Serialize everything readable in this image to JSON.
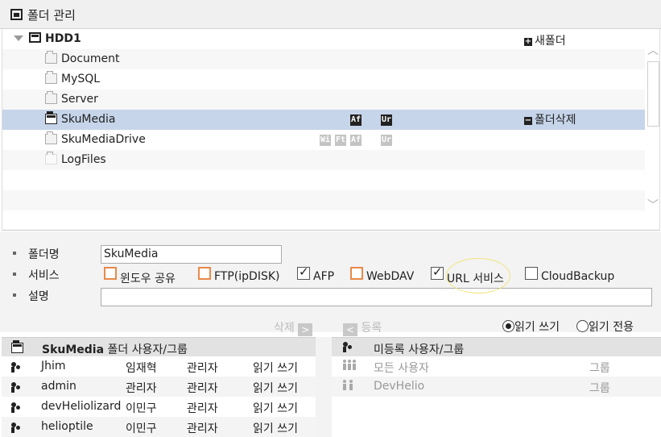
{
  "title": "폴더 관리",
  "tree": {
    "root": "HDD1",
    "new_folder": "새폴더",
    "delete_folder": "폴더삭제",
    "folders": [
      {
        "name": "Document",
        "badges": []
      },
      {
        "name": "MySQL",
        "badges": []
      },
      {
        "name": "Server",
        "badges": []
      },
      {
        "name": "SkuMedia",
        "badges": [
          "Af",
          "Ur"
        ],
        "selected": true
      },
      {
        "name": "SkuMediaDrive",
        "badges": [
          "Wi",
          "Ft",
          "Af",
          "Ur"
        ]
      },
      {
        "name": "LogFiles",
        "badges": []
      }
    ]
  },
  "form": {
    "folder_name_label": "폴더명",
    "folder_name_value": "SkuMedia",
    "service_label": "서비스",
    "description_label": "설명",
    "description_value": "",
    "services": [
      {
        "label": "윈도우 공유",
        "checked": false,
        "highlight": true
      },
      {
        "label": "FTP(ipDISK)",
        "checked": false,
        "highlight": true
      },
      {
        "label": "AFP",
        "checked": true,
        "highlight": false
      },
      {
        "label": "WebDAV",
        "checked": false,
        "highlight": true
      },
      {
        "label": "URL 서비스",
        "checked": true,
        "highlight": false
      },
      {
        "label": "CloudBackup",
        "checked": false,
        "highlight": false
      }
    ]
  },
  "actions": {
    "delete": "삭제",
    "register": "등록",
    "read_write": "읽기 쓰기",
    "read_only": "읽기 전용",
    "selected_permission": "read_write"
  },
  "left_panel": {
    "header_bold": "SkuMedia",
    "header_rest": " 폴더 사용자/그룹",
    "rows": [
      {
        "id": "Jhim",
        "name": "임재혁",
        "role": "관리자",
        "perm": "읽기 쓰기"
      },
      {
        "id": "admin",
        "name": "관리자",
        "role": "관리자",
        "perm": "읽기 쓰기"
      },
      {
        "id": "devHeliolizard",
        "name": "이민구",
        "role": "관리자",
        "perm": "읽기 쓰기"
      },
      {
        "id": "helioptile",
        "name": "이민구",
        "role": "관리자",
        "perm": "읽기 쓰기"
      }
    ]
  },
  "right_panel": {
    "header": "미등록 사용자/그룹",
    "rows": [
      {
        "name": "모든 사용자",
        "type": "그룹"
      },
      {
        "name": "DevHelio",
        "type": "그룹"
      }
    ]
  },
  "colors": {
    "selected_row": "#c6d5ea",
    "highlight_checkbox": "#e8894a",
    "annotation_ring": "#f0e57a"
  }
}
